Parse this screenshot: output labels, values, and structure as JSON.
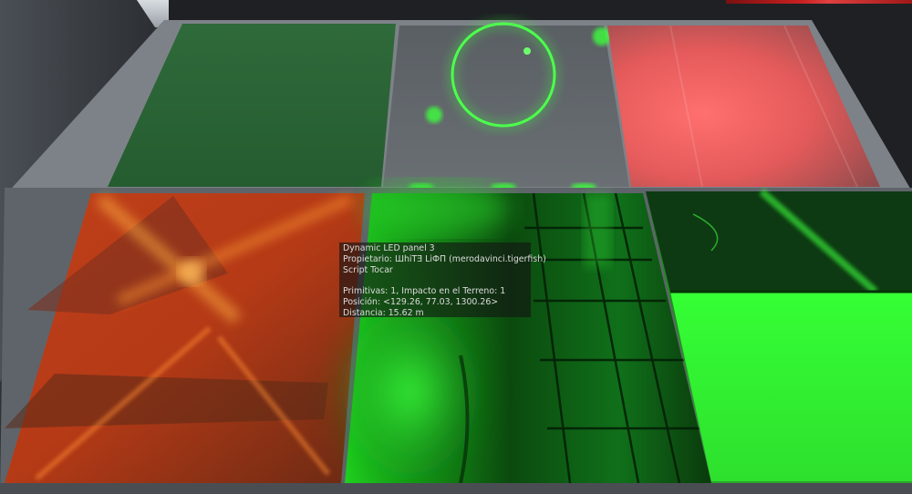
{
  "hover_tip": {
    "object_name": "Dynamic LED panel 3",
    "owner_line": "Propietario: ШhiТƎ LiФП (merodavinci.tigerfish)",
    "script_line": "Script Tocar",
    "primitives_line": "Primitivas: 1, Impacto en el Terreno: 1",
    "position_line": "Posición: <129.26, 77.03, 1300.26>",
    "distance_line": "Distancia: 15.62 m"
  },
  "colors": {
    "led_green": "#39ff33",
    "led_red": "#ff6a6a",
    "led_orange": "#ff7a1a",
    "wall": "#3a3e43",
    "frame": "#8a8f96"
  }
}
